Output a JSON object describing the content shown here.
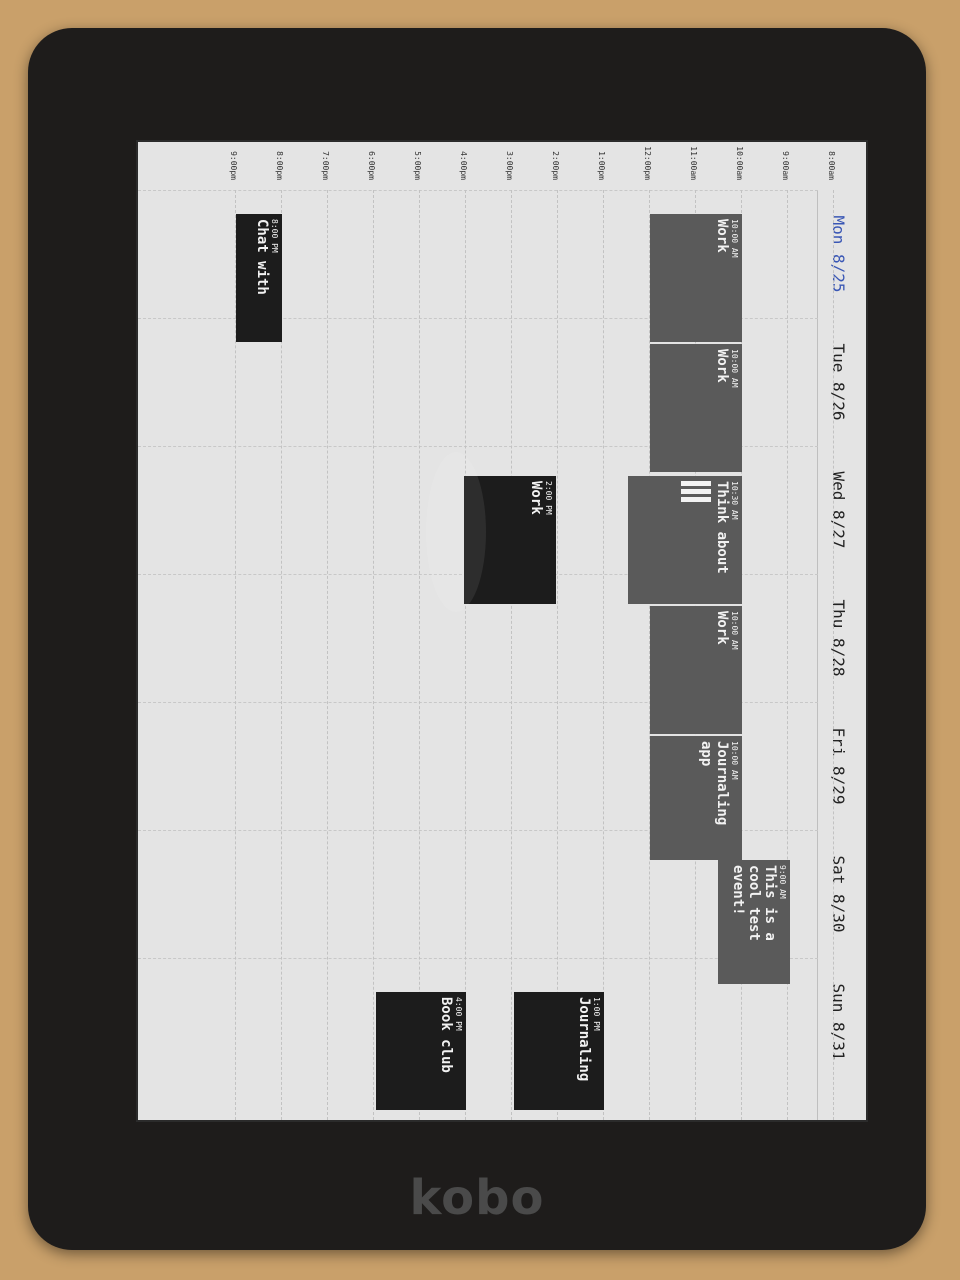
{
  "device": {
    "brand": "kobo"
  },
  "calendar": {
    "days": [
      {
        "label": "Mon 8/25",
        "today": true
      },
      {
        "label": "Tue 8/26",
        "today": false
      },
      {
        "label": "Wed 8/27",
        "today": false
      },
      {
        "label": "Thu 8/28",
        "today": false
      },
      {
        "label": "Fri 8/29",
        "today": false
      },
      {
        "label": "Sat 8/30",
        "today": false
      },
      {
        "label": "Sun 8/31",
        "today": false
      }
    ],
    "hours": [
      "8:00am",
      "9:00am",
      "10:00am",
      "11:00am",
      "12:00pm",
      "1:00pm",
      "2:00pm",
      "3:00pm",
      "4:00pm",
      "5:00pm",
      "6:00pm",
      "7:00pm",
      "8:00pm",
      "9:00pm"
    ],
    "events": [
      {
        "time": "10:00 AM",
        "title": "Work"
      },
      {
        "time": "10:00 AM",
        "title": "Work"
      },
      {
        "time": "10:30 AM",
        "title": "Think about"
      },
      {
        "time": "2:00 PM",
        "title": "Work"
      },
      {
        "time": "10:00 AM",
        "title": "Work"
      },
      {
        "time": "10:00 AM",
        "title": "Journaling app"
      },
      {
        "time": "9:00 AM",
        "title": "This is a cool test event!"
      },
      {
        "time": "1:00 PM",
        "title": "Journaling"
      },
      {
        "time": "4:00 PM",
        "title": "Book club"
      },
      {
        "time": "8:00 PM",
        "title": "Chat with"
      }
    ],
    "colors": {
      "accent": "#3a57b5",
      "event_gray": "#5a5a5a",
      "event_dark": "#1c1c1c"
    }
  }
}
